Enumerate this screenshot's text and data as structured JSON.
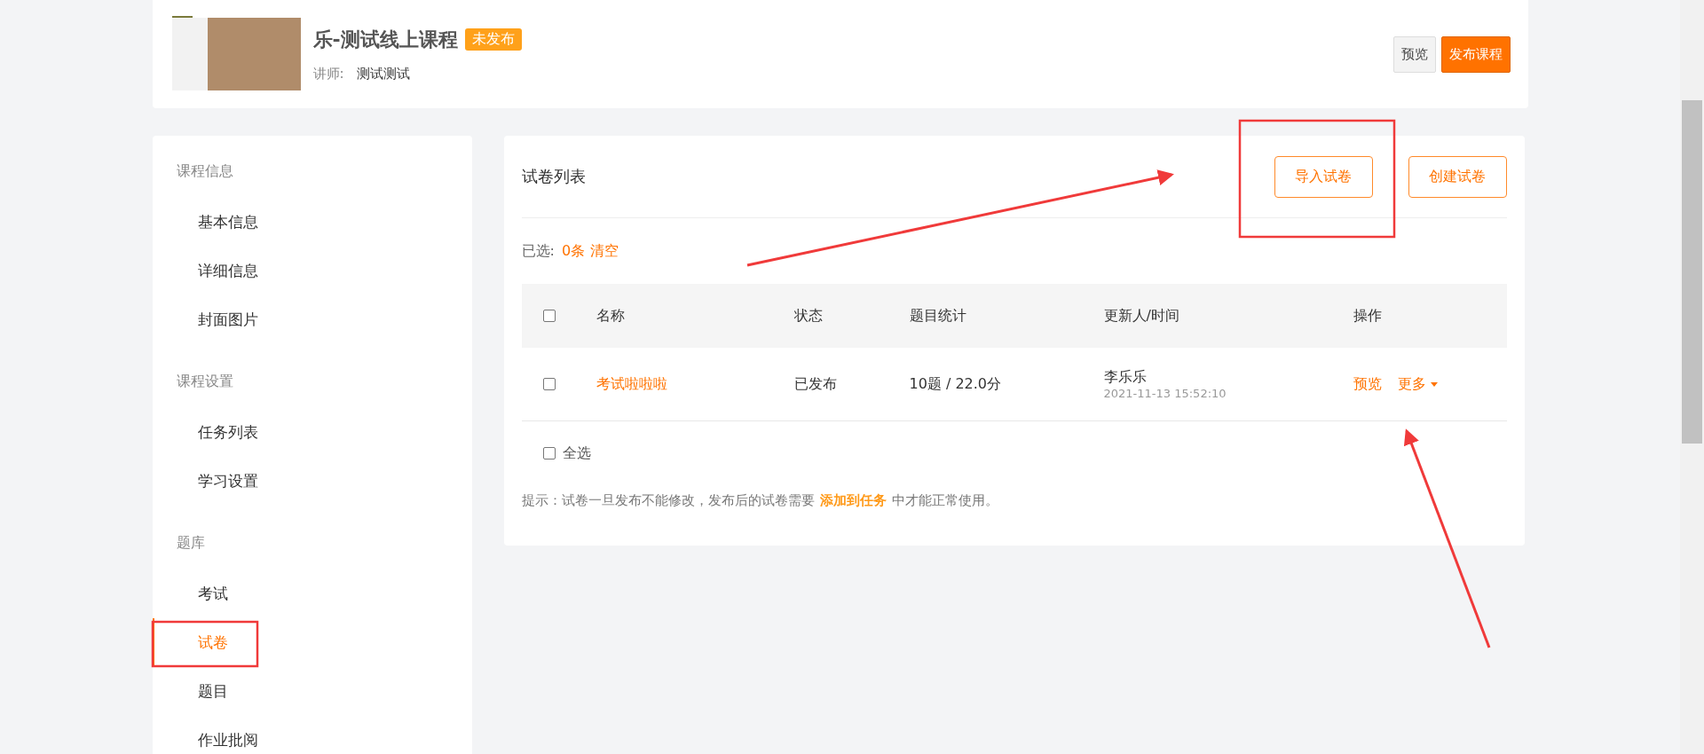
{
  "header": {
    "title": "乐-测试线上课程",
    "status_badge": "未发布",
    "lecturer_label": "讲师:",
    "lecturer": "测试测试",
    "buttons": [
      {
        "label": "预览",
        "kind": "default"
      },
      {
        "label": "发布课程",
        "kind": "primary"
      }
    ]
  },
  "sidebar": {
    "sections": [
      {
        "title": "课程信息",
        "items": [
          {
            "label": "基本信息",
            "selected": false
          },
          {
            "label": "详细信息",
            "selected": false
          },
          {
            "label": "封面图片",
            "selected": false
          }
        ]
      },
      {
        "title": "课程设置",
        "items": [
          {
            "label": "任务列表",
            "selected": false
          },
          {
            "label": "学习设置",
            "selected": false
          }
        ]
      },
      {
        "title": "题库",
        "items": [
          {
            "label": "考试",
            "selected": false
          },
          {
            "label": "试卷",
            "selected": true
          },
          {
            "label": "题目",
            "selected": false
          },
          {
            "label": "作业批阅",
            "selected": false
          }
        ]
      }
    ]
  },
  "panel": {
    "title": "试卷列表",
    "buttons": [
      "导入试卷",
      "创建试卷"
    ],
    "selection": {
      "label": "已选:",
      "count": "0条",
      "clear": "清空"
    },
    "table": {
      "header_checked": false,
      "columns": [
        "名称",
        "状态",
        "题目统计",
        "更新人/时间",
        "操作"
      ],
      "rows": [
        {
          "checked": false,
          "name": "考试啦啦啦",
          "status": "已发布",
          "stats": "10题 / 22.0分",
          "updater": "李乐乐",
          "time": "2021-11-13 15:52:10",
          "actions": [
            "预览",
            "更多"
          ]
        }
      ]
    },
    "select_all": {
      "label": "全选",
      "checked": false
    },
    "tip": {
      "before": "提示：试卷一旦发布不能修改，发布后的试卷需要",
      "link": "添加到任务",
      "after": "中才能正常使用。"
    }
  }
}
